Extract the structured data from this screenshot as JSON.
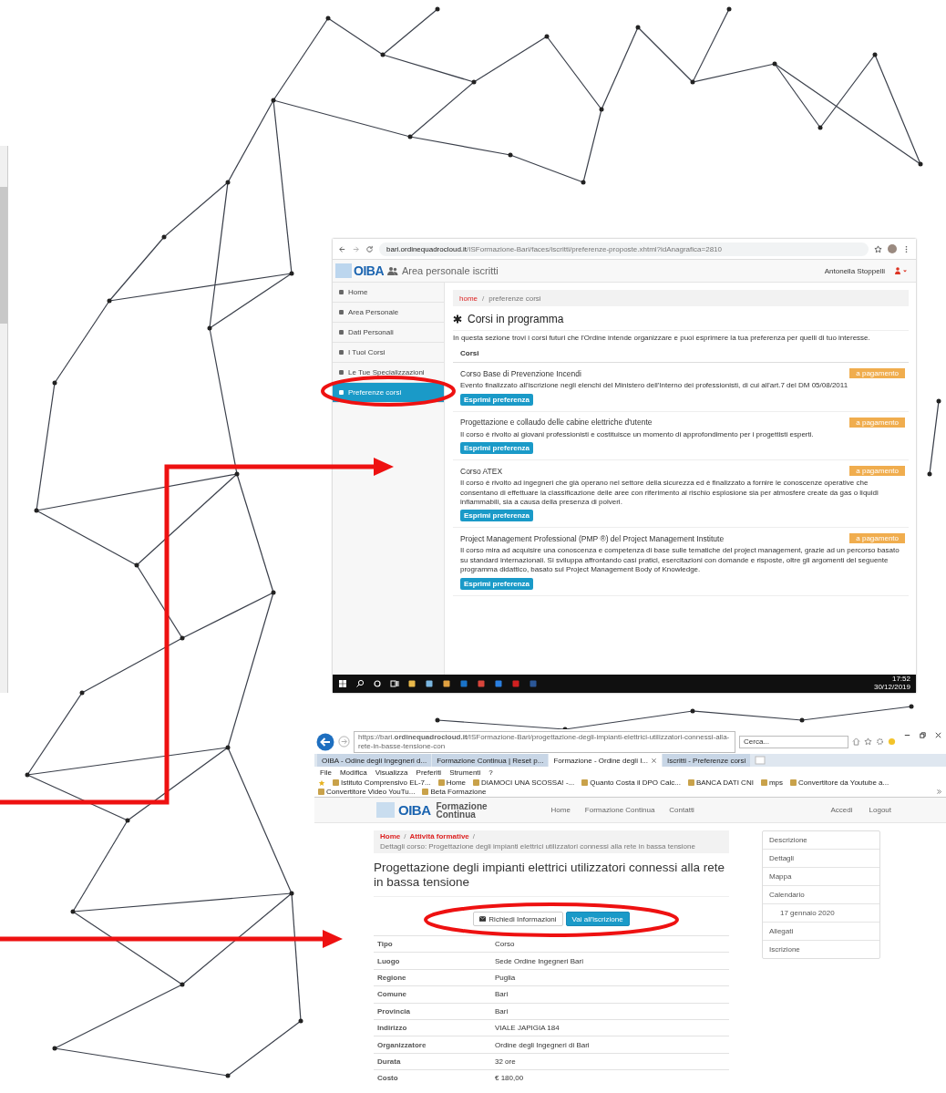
{
  "screenshot_1": {
    "address_bar": {
      "host": "bari.ordinequadrocloud.it",
      "path": "/ISFormazione-Bari/faces/iscritti/preferenze-proposte.xhtml?idAnagrafica=2810"
    },
    "header": {
      "logo": "OIBA",
      "title": "Area personale iscritti",
      "user": "Antonella Stoppelli"
    },
    "sidebar": {
      "items": [
        {
          "label": "Home",
          "selected": false
        },
        {
          "label": "Area Personale",
          "selected": false
        },
        {
          "label": "Dati Personali",
          "selected": false
        },
        {
          "label": "I Tuoi Corsi",
          "selected": false
        },
        {
          "label": "Le Tue Specializzazioni",
          "selected": false
        },
        {
          "label": "Preferenze corsi",
          "selected": true
        }
      ]
    },
    "breadcrumb": {
      "link": "home",
      "separator": "/",
      "current": "preferenze corsi"
    },
    "heading": "Corsi in programma",
    "intro": "In questa sezione trovi i corsi futuri che l'Ordine intende organizzare e puoi esprimere la tua preferenza per quelli di tuo interesse.",
    "list_header": "Corsi",
    "courses": [
      {
        "title": "Corso Base di Prevenzione Incendi",
        "badge": "a pagamento",
        "description": "Evento finalizzato all'iscrizione negli elenchi del Ministero dell'Interno dei professionisti, di cui all'art.7 del DM 05/08/2011",
        "button": "Esprimi preferenza"
      },
      {
        "title": "Progettazione e collaudo delle cabine elettriche d'utente",
        "badge": "a pagamento",
        "description": "Il corso è rivolto ai giovani professionisti e costituisce un momento di approfondimento per i progettisti esperti.",
        "button": "Esprimi preferenza"
      },
      {
        "title": "Corso ATEX",
        "badge": "a pagamento",
        "description": "Il corso è rivolto ad ingegneri che già operano nel settore della sicurezza ed è finalizzato a fornire le conoscenze operative che consentano di effettuare la classificazione delle aree con riferimento al rischio esplosione sia per atmosfere create da gas o liquidi infiammabili, sia a causa della presenza di polveri.",
        "button": "Esprimi preferenza"
      },
      {
        "title": "Project Management Professional (PMP ®) del Project Management Institute",
        "badge": "a pagamento",
        "description": "Il corso mira ad acquisire una conoscenza e competenza di base sulle tematiche del project management, grazie ad un percorso basato su standard internazionali. Si sviluppa affrontando casi pratici, esercitazioni con domande e risposte, oltre gli argomenti del seguente programma didattico, basato sul Project Management Body of Knowledge.",
        "button": "Esprimi preferenza"
      }
    ],
    "taskbar": {
      "time": "17:52",
      "date": "30/12/2019"
    }
  },
  "screenshot_2": {
    "address_bar": {
      "url": "https://bari.**ordinequadrocloud.it**/ISFormazione-Bari/progettazione-degli-impianti-elettrici-utilizzatori-connessi-alla-rete-in-basse-tensione-con",
      "search_placeholder": "Cerca..."
    },
    "tabs": [
      {
        "label": "OIBA - Odine degli Ingegneri d...",
        "selected": false
      },
      {
        "label": "Formazione Continua | Reset p...",
        "selected": false
      },
      {
        "label": "Formazione - Ordine degli I...",
        "selected": true
      },
      {
        "label": "Iscritti - Preferenze corsi",
        "selected": false
      }
    ],
    "menu": [
      "File",
      "Modifica",
      "Visualizza",
      "Preferiti",
      "Strumenti",
      "?"
    ],
    "bookmarks": [
      "Istituto Comprensivo EL-7...",
      "Home",
      "DIAMOCI UNA SCOSSA! -...",
      "Quanto Costa il DPO Calc...",
      "BANCA DATI CNI",
      "mps",
      "Convertitore da Youtube a...",
      "Convertitore Video YouTu...",
      "Beta Formazione"
    ],
    "site_header": {
      "logo": "OIBA",
      "brand": "Formazione Continua",
      "nav": [
        "Home",
        "Formazione Continua",
        "Contatti"
      ],
      "login": "Accedi",
      "logout": "Logout"
    },
    "breadcrumb": {
      "links": [
        "Home",
        "Attività formative"
      ],
      "separator": "/",
      "current": "Dettagli corso: Progettazione degli impianti elettrici utilizzatori connessi alla rete in bassa tensione"
    },
    "title": "Progettazione degli impianti elettrici utilizzatori connessi alla rete in bassa tensione",
    "buttons": [
      {
        "label": "Richiedi Informazioni",
        "kind": "default"
      },
      {
        "label": "Vai all'iscrizione",
        "kind": "primary"
      }
    ],
    "details": [
      {
        "label": "Tipo",
        "value": "Corso"
      },
      {
        "label": "Luogo",
        "value": "Sede Ordine Ingegneri Bari"
      },
      {
        "label": "Regione",
        "value": "Puglia"
      },
      {
        "label": "Comune",
        "value": "Bari"
      },
      {
        "label": "Provincia",
        "value": "Bari"
      },
      {
        "label": "Indirizzo",
        "value": "VIALE JAPIGIA 184"
      },
      {
        "label": "Organizzatore",
        "value": "Ordine degli Ingegneri di Bari"
      },
      {
        "label": "Durata",
        "value": "32 ore"
      },
      {
        "label": "Costo",
        "value": "€ 180,00"
      }
    ],
    "side_nav": [
      {
        "label": "Descrizione",
        "kind": "link"
      },
      {
        "label": "Dettagli",
        "kind": "link"
      },
      {
        "label": "Mappa",
        "kind": "link"
      },
      {
        "label": "Calendario",
        "kind": "link"
      },
      {
        "label": "17 gennaio 2020",
        "kind": "date"
      },
      {
        "label": "Allegati",
        "kind": "link"
      },
      {
        "label": "Iscrizione",
        "kind": "link"
      }
    ]
  }
}
